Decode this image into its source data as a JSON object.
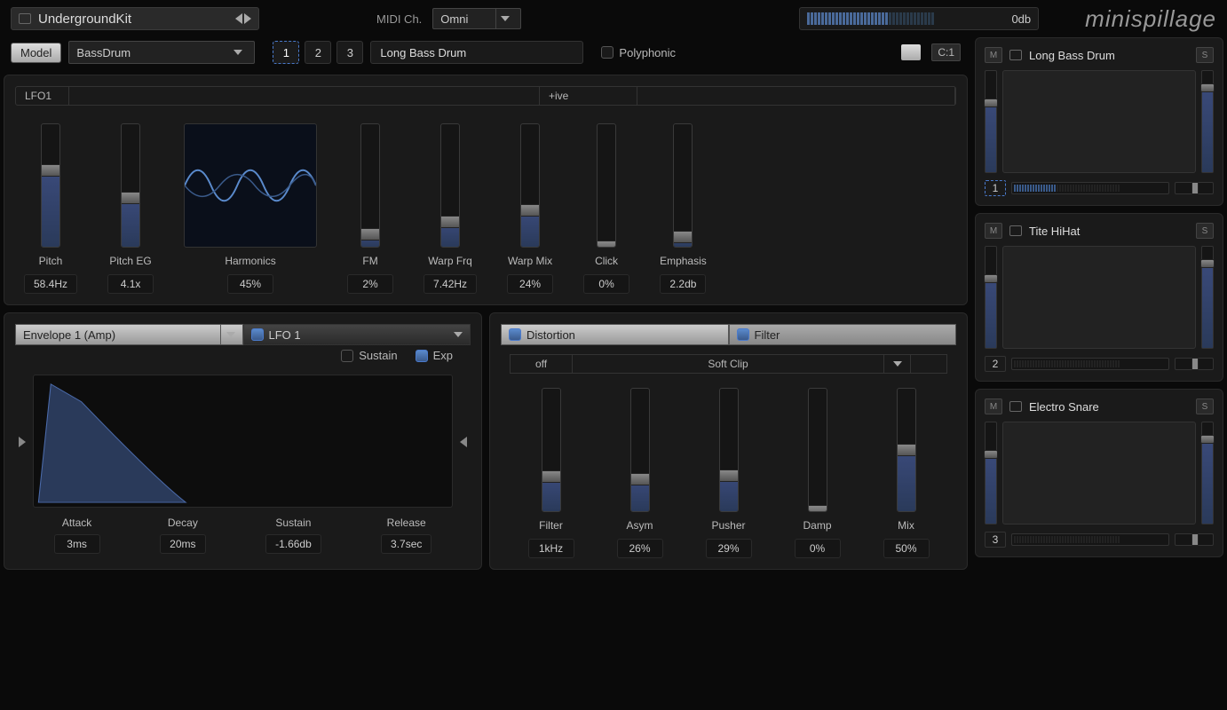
{
  "header": {
    "preset_name": "UndergroundKit",
    "midi_label": "MIDI Ch.",
    "midi_value": "Omni",
    "vu_db": "0db",
    "logo": "minispillage"
  },
  "modelbar": {
    "model_btn": "Model",
    "model_name": "BassDrum",
    "slots": [
      "1",
      "2",
      "3"
    ],
    "active_slot": 0,
    "instrument_name": "Long Bass Drum",
    "polyphonic_label": "Polyphonic",
    "ci_label": "C:1"
  },
  "osc": {
    "lfo_header": [
      "LFO1",
      "",
      "+ive",
      ""
    ],
    "params": [
      {
        "label": "Pitch",
        "value": "58.4Hz",
        "fill": 62
      },
      {
        "label": "Pitch EG",
        "value": "4.1x",
        "fill": 40
      },
      {
        "label": "Harmonics",
        "value": "45%",
        "type": "harmonics"
      },
      {
        "label": "FM",
        "value": "2%",
        "fill": 10
      },
      {
        "label": "Warp Frq",
        "value": "7.42Hz",
        "fill": 20
      },
      {
        "label": "Warp Mix",
        "value": "24%",
        "fill": 30
      },
      {
        "label": "Click",
        "value": "0%",
        "fill": 0
      },
      {
        "label": "Emphasis",
        "value": "2.2db",
        "fill": 8
      }
    ]
  },
  "env": {
    "tab1": "Envelope 1 (Amp)",
    "tab2": "LFO 1",
    "sustain_label": "Sustain",
    "exp_label": "Exp",
    "params": [
      {
        "label": "Attack",
        "value": "3ms"
      },
      {
        "label": "Decay",
        "value": "20ms"
      },
      {
        "label": "Sustain",
        "value": "-1.66db"
      },
      {
        "label": "Release",
        "value": "3.7sec"
      }
    ]
  },
  "fx": {
    "tab1": "Distortion",
    "tab2": "Filter",
    "mode1": "off",
    "mode2": "Soft Clip",
    "params": [
      {
        "label": "Filter",
        "value": "1kHz",
        "fill": 28
      },
      {
        "label": "Asym",
        "value": "26%",
        "fill": 26
      },
      {
        "label": "Pusher",
        "value": "29%",
        "fill": 29
      },
      {
        "label": "Damp",
        "value": "0%",
        "fill": 0
      },
      {
        "label": "Mix",
        "value": "50%",
        "fill": 50
      }
    ]
  },
  "pads": [
    {
      "name": "Long Bass Drum",
      "num": "1",
      "selected": true,
      "vu_lit": 16
    },
    {
      "name": "Tite HiHat",
      "num": "2",
      "selected": false,
      "vu_lit": 0
    },
    {
      "name": "Electro Snare",
      "num": "3",
      "selected": false,
      "vu_lit": 0
    }
  ],
  "icons": {
    "mute": "M",
    "solo": "S"
  }
}
